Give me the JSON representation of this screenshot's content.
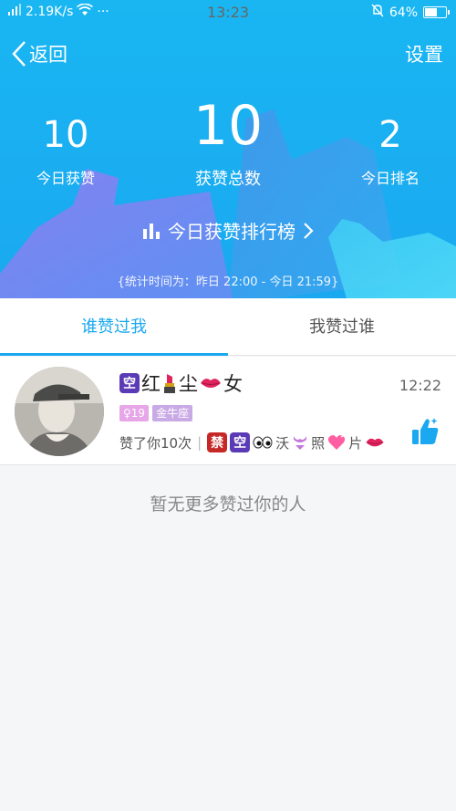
{
  "status_bar": {
    "network": "2.19K/s",
    "time": "13:23",
    "battery": "64%",
    "battery_level": 0.64
  },
  "nav": {
    "back_label": "返回",
    "settings_label": "设置"
  },
  "stats": {
    "today_likes": {
      "value": "10",
      "label": "今日获赞"
    },
    "total_likes": {
      "value": "10",
      "label": "获赞总数"
    },
    "today_rank": {
      "value": "2",
      "label": "今日排名"
    }
  },
  "ranking_link": "今日获赞排行榜",
  "stat_period": "{统计时间为：昨日 22:00 - 今日 21:59}",
  "tabs": {
    "active": "谁赞过我",
    "inactive": "我赞过谁"
  },
  "list": [
    {
      "name_parts": [
        "红",
        "尘",
        "女"
      ],
      "name_icons": [
        "kong-badge-icon",
        "lipstick-icon",
        "lips-icon"
      ],
      "time": "12:22",
      "age_tag": "♀19",
      "zodiac_tag": "金牛座",
      "liked_count_text": "赞了你10次",
      "signature_parts": [
        "沃",
        "照",
        "片"
      ],
      "signature_icons": [
        "jin-badge-icon",
        "kong-badge-icon",
        "eyes-icon",
        "bikini-icon",
        "heart-icon",
        "lips-icon"
      ]
    }
  ],
  "badges": {
    "kong": "空",
    "jin": "禁"
  },
  "empty_text": "暂无更多赞过你的人",
  "colors": {
    "header": "#19b6f2",
    "accent": "#1aa8f0",
    "tag_age": "#e6a6e8",
    "tag_zodiac": "#c9a9e6"
  }
}
